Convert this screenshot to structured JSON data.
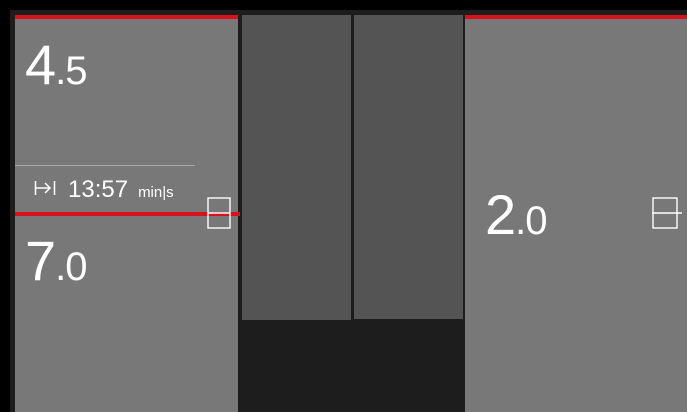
{
  "zones": {
    "left_top": {
      "value_whole": "4",
      "value_decimal": ".5"
    },
    "left_bottom": {
      "value_whole": "7",
      "value_decimal": ".0"
    },
    "right": {
      "value_whole": "2",
      "value_decimal": ".0"
    }
  },
  "timer": {
    "icon": "timer-end-icon",
    "value": "13:57",
    "unit": "min|s"
  },
  "icons": {
    "cooktop_left": "cooktop-zone-icon",
    "cooktop_right": "cooktop-zone-icon"
  },
  "colors": {
    "accent": "#d8121d",
    "zone_background": "#787878",
    "panel_background": "#545454",
    "frame_background": "#1d1d1d"
  }
}
